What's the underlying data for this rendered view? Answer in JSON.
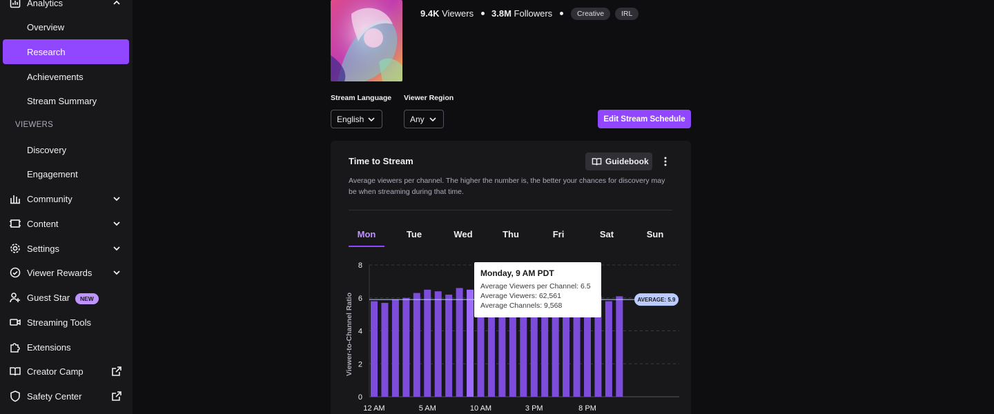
{
  "sidebar": {
    "analytics_label": "Analytics",
    "analytics_items": [
      "Overview",
      "Research",
      "Achievements",
      "Stream Summary"
    ],
    "viewers_section": "VIEWERS",
    "viewers_items": [
      "Discovery",
      "Engagement"
    ],
    "groups": [
      {
        "label": "Community",
        "icon": "community-icon"
      },
      {
        "label": "Content",
        "icon": "content-icon"
      },
      {
        "label": "Settings",
        "icon": "gear-icon"
      },
      {
        "label": "Viewer Rewards",
        "icon": "rewards-icon"
      },
      {
        "label": "Guest Star",
        "icon": "guest-star-icon",
        "badge": "NEW"
      },
      {
        "label": "Streaming Tools",
        "icon": "camera-icon"
      },
      {
        "label": "Extensions",
        "icon": "puzzle-icon"
      },
      {
        "label": "Creator Camp",
        "icon": "book-icon"
      },
      {
        "label": "Safety Center",
        "icon": "shield-icon"
      }
    ]
  },
  "header": {
    "viewers_count": "9.4K",
    "viewers_label": "Viewers",
    "followers_count": "3.8M",
    "followers_label": "Followers",
    "tags": [
      "Creative",
      "IRL"
    ]
  },
  "filters": {
    "language_label": "Stream Language",
    "language_value": "English",
    "region_label": "Viewer Region",
    "region_value": "Any",
    "edit_button": "Edit Stream Schedule"
  },
  "card": {
    "title": "Time to Stream",
    "guidebook": "Guidebook",
    "description": "Average viewers per channel. The higher the number is, the better your chances for discovery may be when streaming during that time.",
    "days": [
      "Mon",
      "Tue",
      "Wed",
      "Thu",
      "Fri",
      "Sat",
      "Sun"
    ],
    "active_day": "Mon"
  },
  "tooltip": {
    "title": "Monday, 9 AM PDT",
    "line1": "Average Viewers per Channel: 6.5",
    "line2": "Average Viewers: 62,561",
    "line3": "Average Channels: 9,568"
  },
  "colors": {
    "accent": "#9147ff",
    "bar": "#7d4cdb",
    "bar_highlight": "#9f6bff",
    "average_badge": "#bcccff"
  },
  "chart_data": {
    "type": "bar",
    "title": "",
    "ylabel": "Viewer-to-Channel Ratio",
    "xlabel": "",
    "ylim": [
      0,
      8
    ],
    "yticks": [
      0,
      2,
      4,
      6,
      8
    ],
    "categories": [
      "12 AM",
      "1 AM",
      "2 AM",
      "3 AM",
      "4 AM",
      "5 AM",
      "6 AM",
      "7 AM",
      "8 AM",
      "9 AM",
      "10 AM",
      "11 AM",
      "12 PM",
      "1 PM",
      "2 PM",
      "3 PM",
      "4 PM",
      "5 PM",
      "6 PM",
      "7 PM",
      "8 PM",
      "9 PM",
      "10 PM",
      "11 PM"
    ],
    "xtick_labels": [
      "12 AM",
      "5 AM",
      "10 AM",
      "3 PM",
      "8 PM"
    ],
    "values": [
      5.8,
      5.7,
      5.9,
      6.0,
      6.3,
      6.5,
      6.4,
      6.2,
      6.6,
      6.5,
      6.1,
      5.9,
      5.9,
      5.9,
      5.9,
      5.9,
      5.9,
      5.9,
      5.8,
      5.9,
      6.0,
      6.1,
      5.8,
      6.1
    ],
    "average": 5.9,
    "average_label": "AVERAGE: 5.9",
    "grid": true
  }
}
